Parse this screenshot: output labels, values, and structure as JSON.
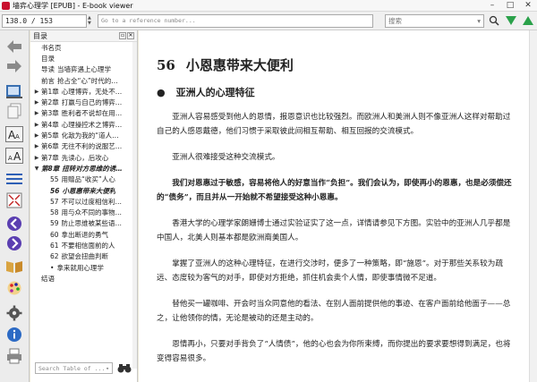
{
  "window": {
    "title": "墙弈心理学 [EPUB] - E-book viewer"
  },
  "toolbar": {
    "position_value": "138.0 / 153",
    "reference_placeholder": "Go to a reference number...",
    "search_placeholder": "搜索"
  },
  "toc": {
    "header": "目录",
    "items": [
      {
        "num": "",
        "label": "书名页",
        "level": "lvl0n",
        "arrow": ""
      },
      {
        "num": "",
        "label": "目录",
        "level": "lvl0n",
        "arrow": ""
      },
      {
        "num": "导读",
        "label": "当墙弈遇上心理学",
        "level": "lvl0n",
        "arrow": ""
      },
      {
        "num": "前言",
        "label": "抢占全“心”时代的…",
        "level": "lvl0n",
        "arrow": ""
      },
      {
        "num": "第1章",
        "label": "心理博弈，无处不…",
        "level": "lvl0",
        "arrow": "▶"
      },
      {
        "num": "第2章",
        "label": "打赢与自己的博弈…",
        "level": "lvl0",
        "arrow": "▶"
      },
      {
        "num": "第3章",
        "label": "胜利者不说却在用…",
        "level": "lvl0",
        "arrow": "▶"
      },
      {
        "num": "第4章",
        "label": "心理操控术之博弈…",
        "level": "lvl0",
        "arrow": "▶"
      },
      {
        "num": "第5章",
        "label": "化敌为我的“道人…",
        "level": "lvl0",
        "arrow": "▶"
      },
      {
        "num": "第6章",
        "label": "无往不利的说服艺…",
        "level": "lvl0",
        "arrow": "▶"
      },
      {
        "num": "第7章",
        "label": "先读心，后攻心",
        "level": "lvl0",
        "arrow": "▶"
      },
      {
        "num": "第8章",
        "label": "扭转对方思维的诱…",
        "level": "lvl0",
        "arrow": "▼",
        "style": "italic"
      },
      {
        "num": "55",
        "label": "用赠品“收买”人心",
        "level": "lvl1",
        "arrow": ""
      },
      {
        "num": "56",
        "label": "小恩惠带来大便利",
        "level": "lvl1",
        "arrow": "",
        "style": "italic"
      },
      {
        "num": "57",
        "label": "不可以过度相信利…",
        "level": "lvl1",
        "arrow": ""
      },
      {
        "num": "58",
        "label": "用与众不同的事物…",
        "level": "lvl1",
        "arrow": ""
      },
      {
        "num": "59",
        "label": "防止思维被某些语…",
        "level": "lvl1",
        "arrow": ""
      },
      {
        "num": "60",
        "label": "拿出断退的勇气",
        "level": "lvl1",
        "arrow": ""
      },
      {
        "num": "61",
        "label": "不要相信面前的人",
        "level": "lvl1",
        "arrow": ""
      },
      {
        "num": "62",
        "label": "欲望会扭曲判断",
        "level": "lvl1",
        "arrow": ""
      },
      {
        "num": "•",
        "label": "拿来就用心理学",
        "level": "lvl1",
        "arrow": ""
      },
      {
        "num": "",
        "label": "结语",
        "level": "lvl0n",
        "arrow": ""
      }
    ],
    "search_placeholder": "Search Table of ..."
  },
  "content": {
    "chapter_num": "56",
    "chapter_title": "小恩惠带来大便利",
    "section_bullet": "●",
    "section_title": "亚洲人的心理特征",
    "paragraphs": [
      {
        "text": "亚洲人容易感受到他人的恩情，报恩意识也比较强烈。而欧洲人和美洲人则不像亚洲人这样对帮助过自己的人感恩戴德，他们习惯于采取彼此间相互帮助、相互回报的交流模式。",
        "bold": false
      },
      {
        "text": "亚洲人很难接受这种交流模式。",
        "bold": false
      },
      {
        "text": "我们对恩惠过于敏感，容易将他人的好意当作“负担”。我们会认为，即使再小的恩惠，也是必须偿还的“债务”，而且并从一开始就不希望接受这种小恩惠。",
        "bold": true
      },
      {
        "text": "香港大学的心理学家朗姗博士通过实验证实了这一点，详情请参见下方图。实验中的亚洲人几乎都是中国人，北美人则基本都是欧洲裔美国人。",
        "bold": false
      },
      {
        "text": "掌握了亚洲人的这种心理特征，在进行交涉时，便多了一种策略，即“施恩”。对于那些关系较为疏远、态度较为客气的对手，即使对方拒绝，抓住机会卖个人情，即使事情微不足道。",
        "bold": false
      },
      {
        "text": "替他买一罐咖啡、开会时当众同意他的看法、在别人面前提供他的事迹、在客户面前给他面子——总之，让他领你的情，无论是被动的还是主动的。",
        "bold": false
      },
      {
        "text": "恩情再小，只要对手背负了“人情债”，他的心也会为你所束缚，而你提出的要求要想得到满足，也将变得容易很多。",
        "bold": false
      }
    ]
  },
  "colors": {
    "accent_green": "#2aa14a",
    "nav_arrow": "#7a7a7a",
    "circle_purple": "#5b3fb1"
  }
}
